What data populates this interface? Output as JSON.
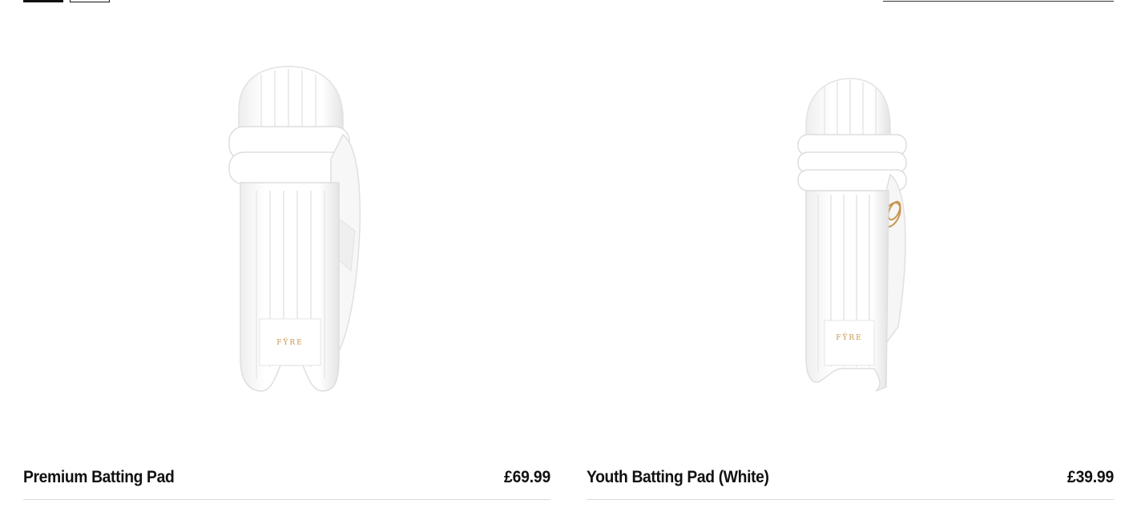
{
  "products": [
    {
      "title": "Premium Batting Pad",
      "price": "£69.99",
      "brand_mark": "FŸRE"
    },
    {
      "title": "Youth Batting Pad (White)",
      "price": "£39.99",
      "brand_mark": "FŸRE"
    }
  ],
  "colors": {
    "pad_white": "#ffffff",
    "pad_shadow": "#e6e6e6",
    "logo_gold": "#c9964e"
  }
}
